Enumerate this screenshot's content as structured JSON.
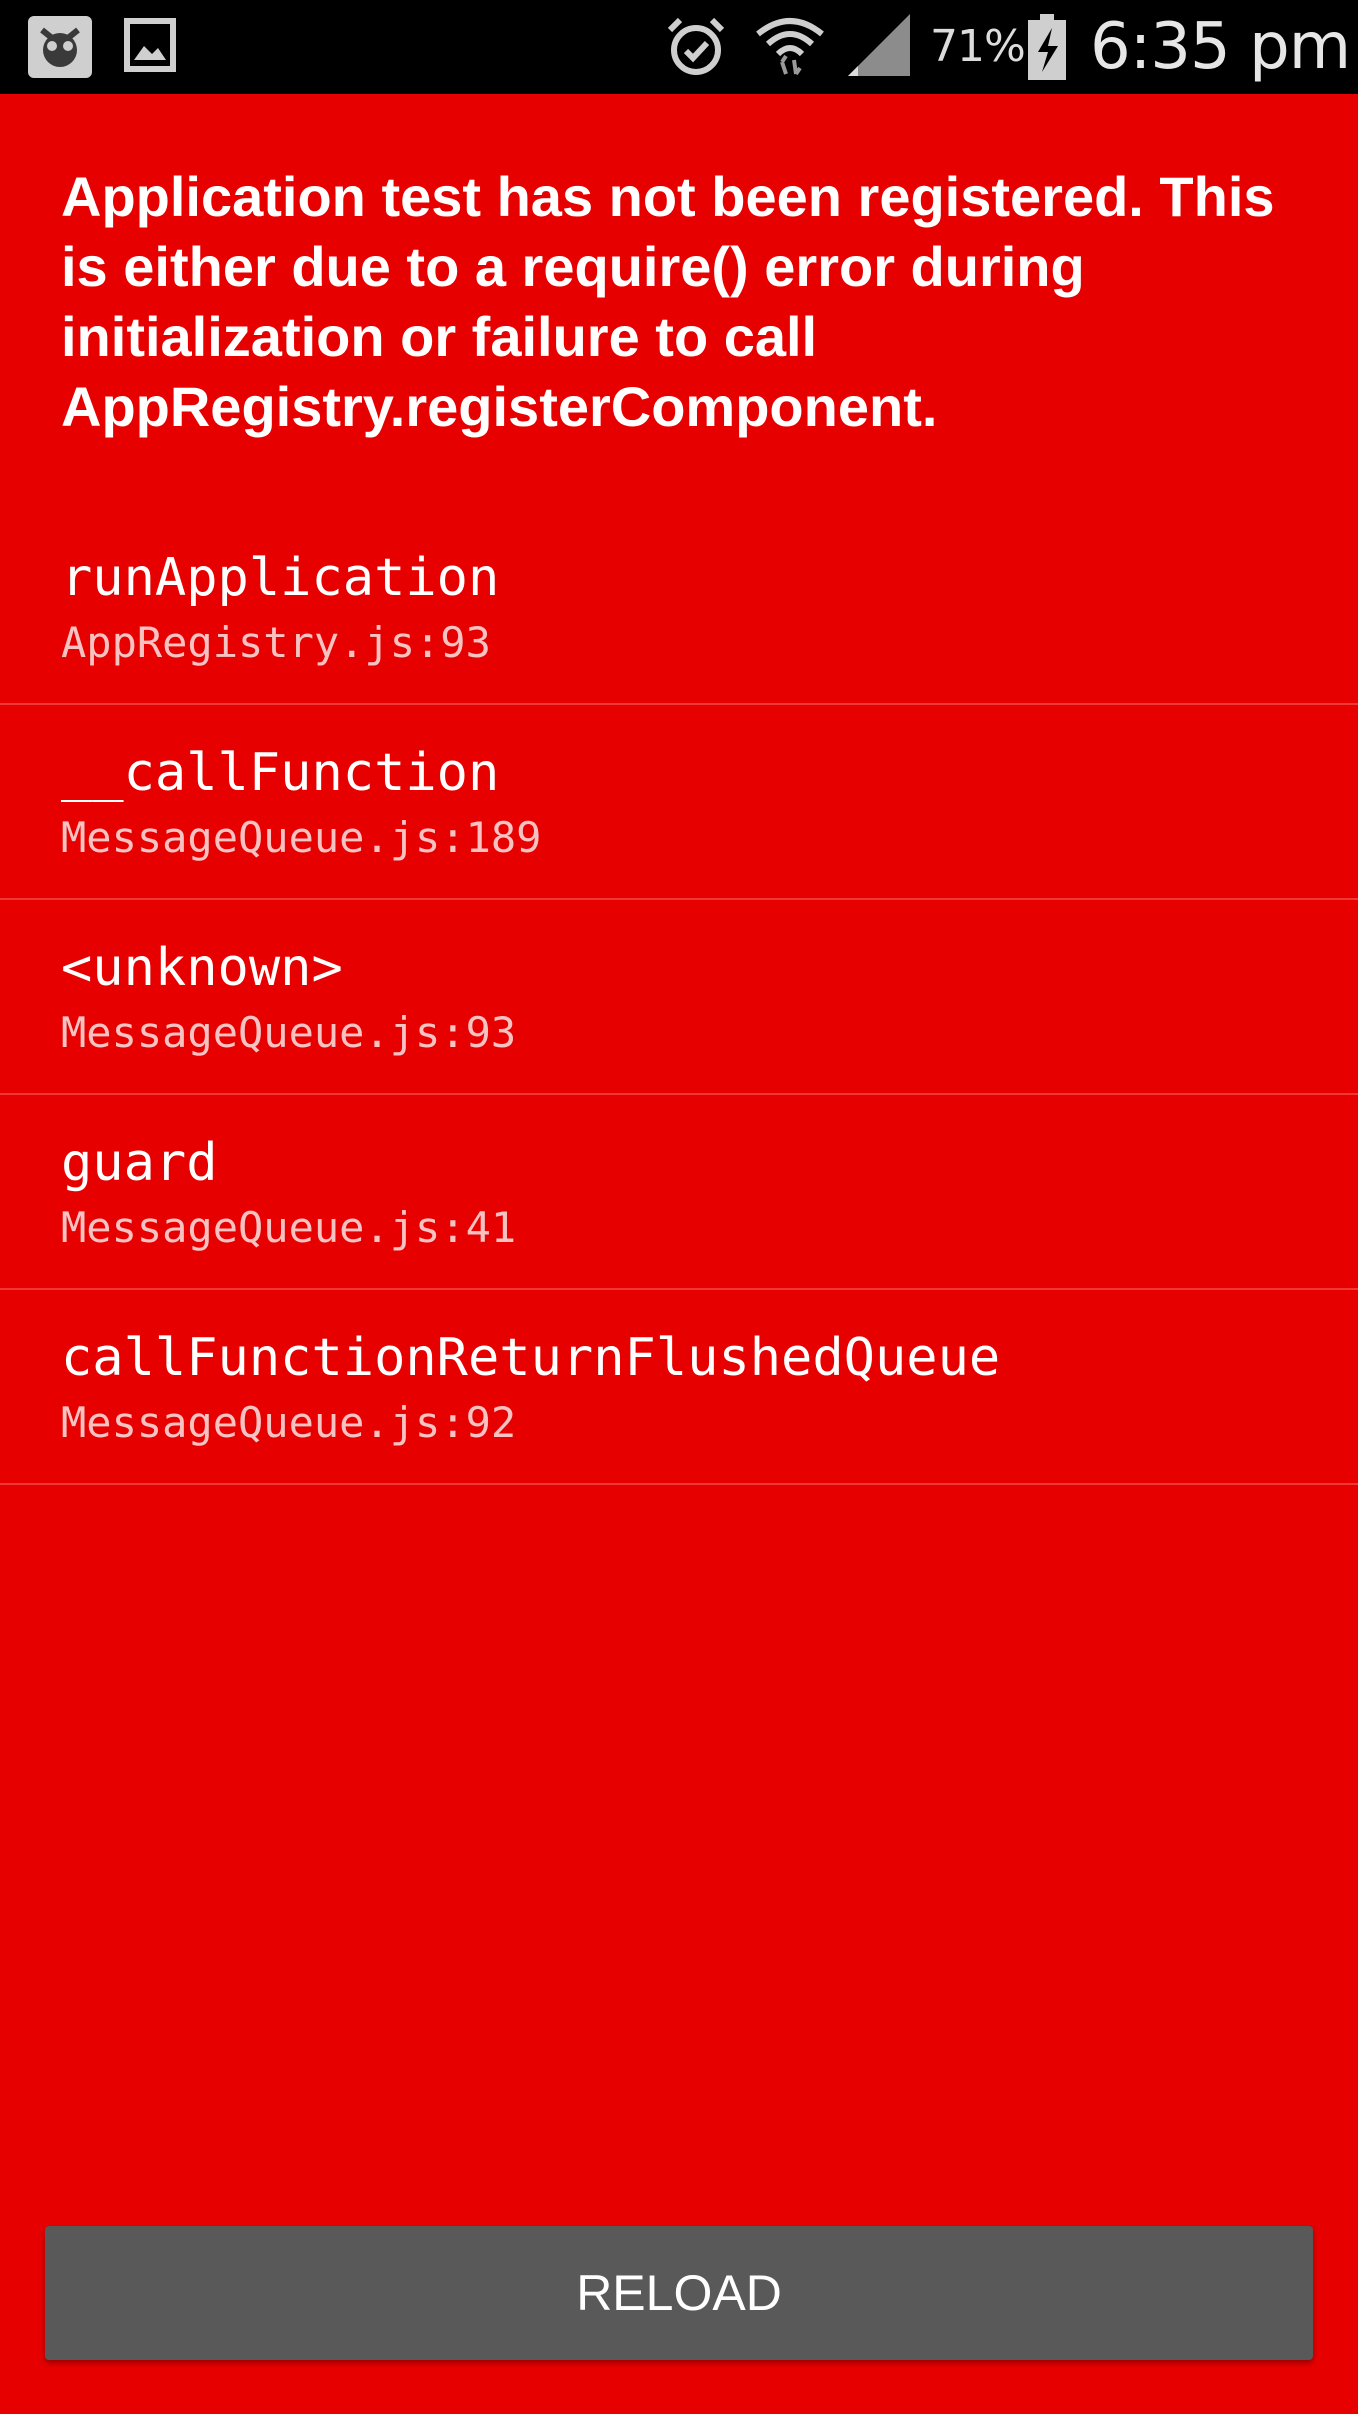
{
  "status_bar": {
    "left_icons": [
      "app-notification-icon",
      "image-notification-icon"
    ],
    "right_icons": [
      "alarm-icon",
      "wifi-icon",
      "signal-icon",
      "battery-charging-icon"
    ],
    "battery_percent": "71%",
    "time": "6:35 pm"
  },
  "error": {
    "title": "Application test has not been registered. This is either due to a require() error during initialization or failure to call AppRegistry.registerComponent.",
    "stack": [
      {
        "method": "runApplication",
        "location": "AppRegistry.js:93"
      },
      {
        "method": "__callFunction",
        "location": "MessageQueue.js:189"
      },
      {
        "method": "<unknown>",
        "location": "MessageQueue.js:93"
      },
      {
        "method": "guard",
        "location": "MessageQueue.js:41"
      },
      {
        "method": "callFunctionReturnFlushedQueue",
        "location": "MessageQueue.js:92"
      }
    ]
  },
  "actions": {
    "reload_label": "RELOAD"
  },
  "colors": {
    "background": "#e60000",
    "button": "#595959",
    "status_bar": "#000000",
    "text": "#ffffff",
    "location_text": "#f6c2c2"
  }
}
